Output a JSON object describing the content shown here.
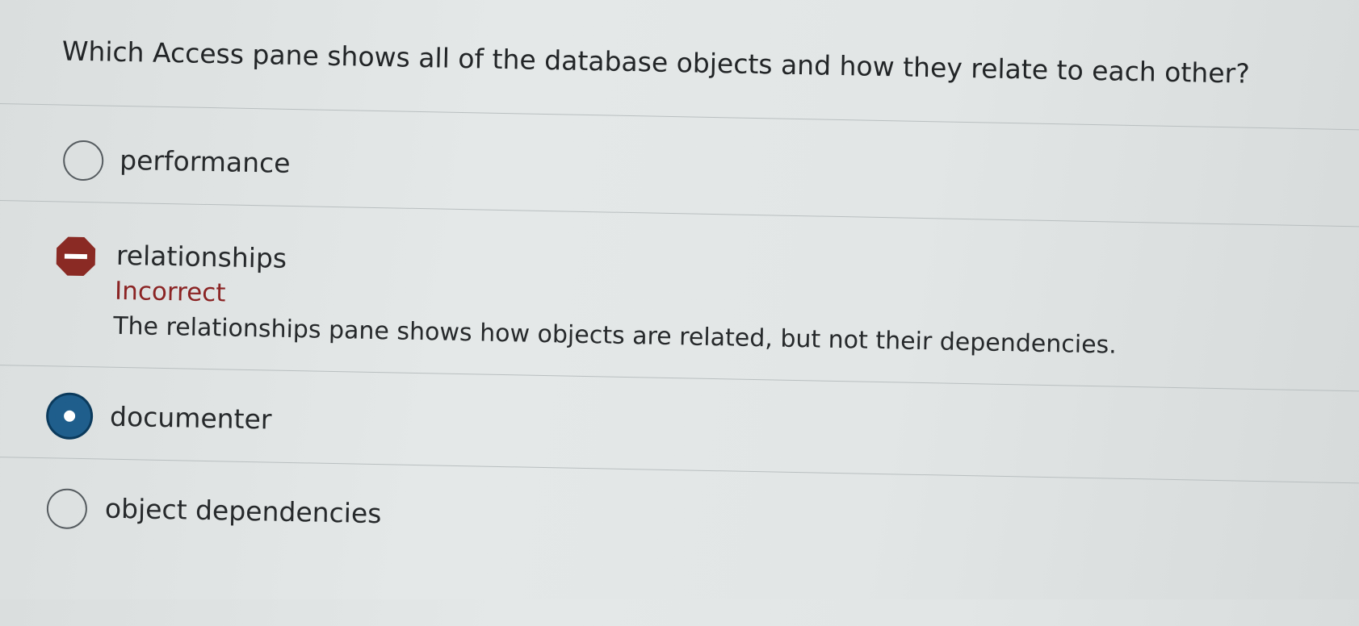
{
  "question": {
    "text": "Which Access pane shows all of the database objects and how they relate to each other?"
  },
  "options": [
    {
      "label": "performance",
      "state": "unselected"
    },
    {
      "label": "relationships",
      "state": "incorrect",
      "feedback_status": "Incorrect",
      "feedback_text": "The relationships pane shows how objects are related, but not their dependencies."
    },
    {
      "label": "documenter",
      "state": "selected"
    },
    {
      "label": "object dependencies",
      "state": "unselected"
    }
  ],
  "colors": {
    "incorrect": "#8b2424",
    "selected": "#1f5e8c",
    "incorrect_icon": "#8a2a24"
  },
  "icons": {
    "incorrect": "stop-icon",
    "selected": "radio-selected-icon",
    "unselected": "radio-empty-icon"
  }
}
